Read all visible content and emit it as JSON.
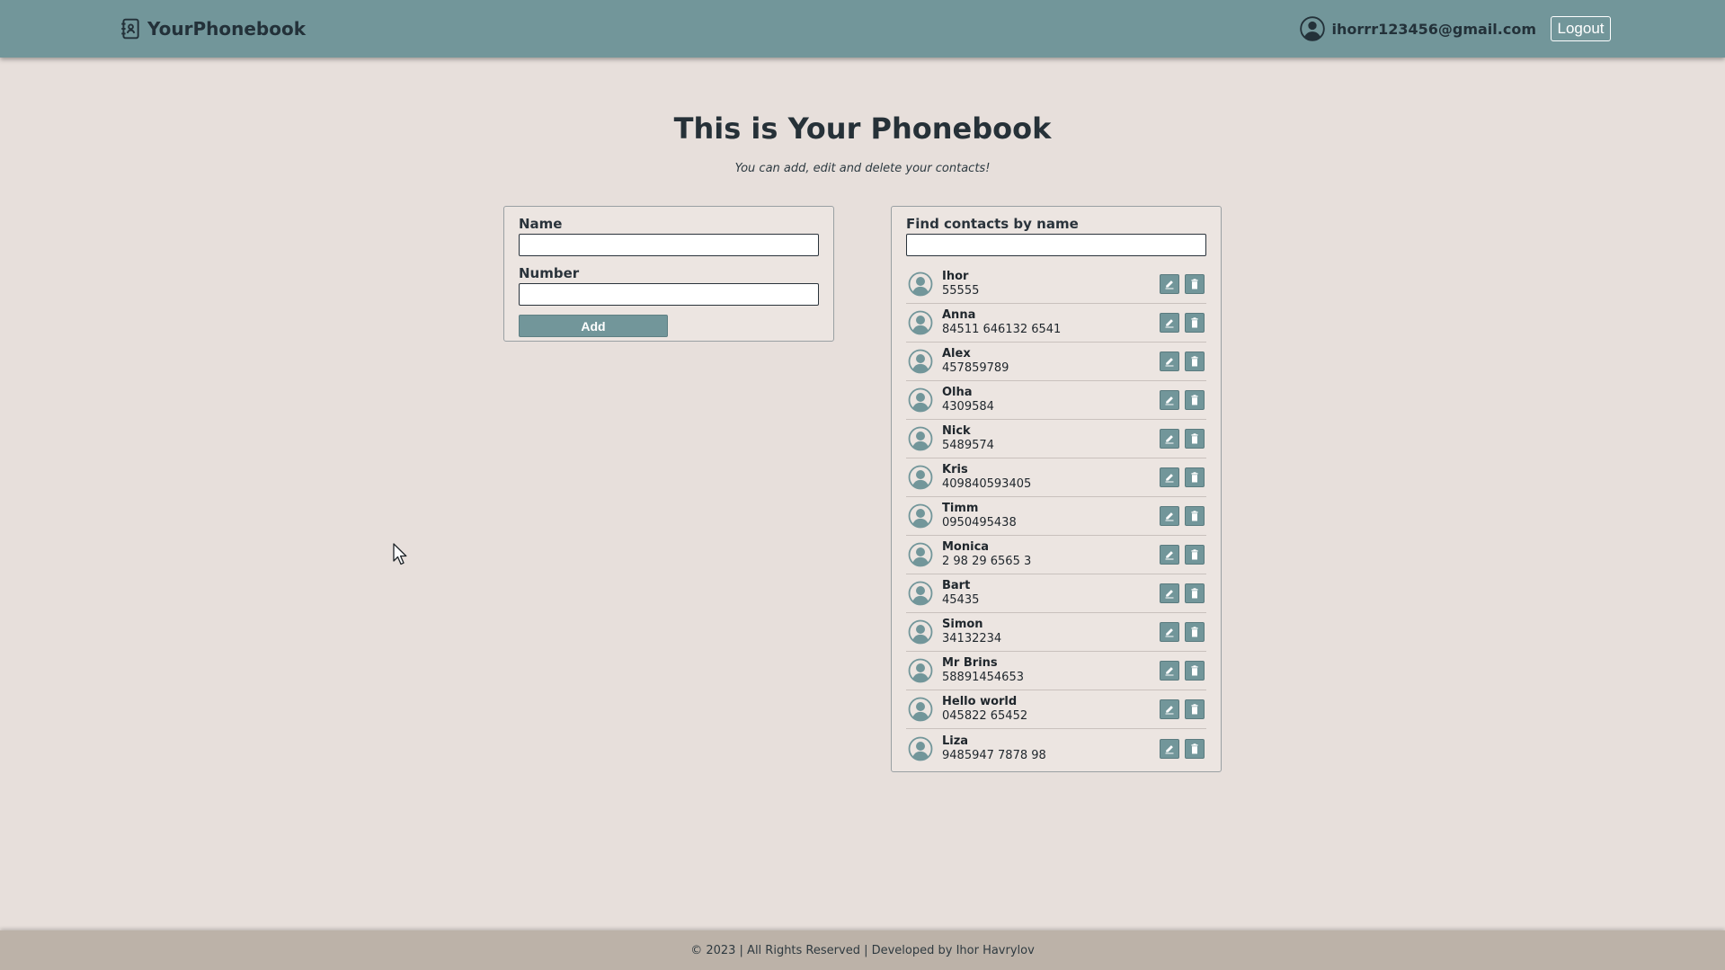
{
  "header": {
    "logo_text": "YourPhonebook",
    "user_email": "ihorrr123456@gmail.com",
    "logout_label": "Logout"
  },
  "main": {
    "title": "This is Your Phonebook",
    "subtitle": "You can add, edit and delete your contacts!"
  },
  "form": {
    "name_label": "Name",
    "name_value": "",
    "number_label": "Number",
    "number_value": "",
    "add_label": "Add"
  },
  "search": {
    "label": "Find contacts by name",
    "value": ""
  },
  "contacts": [
    {
      "name": "Ihor",
      "number": "55555"
    },
    {
      "name": "Anna",
      "number": "84511 646132 6541"
    },
    {
      "name": "Alex",
      "number": "457859789"
    },
    {
      "name": "Olha",
      "number": "4309584"
    },
    {
      "name": "Nick",
      "number": "5489574"
    },
    {
      "name": "Kris",
      "number": "409840593405"
    },
    {
      "name": "Timm",
      "number": "0950495438"
    },
    {
      "name": "Monica",
      "number": "2 98 29 6565 3"
    },
    {
      "name": "Bart",
      "number": "45435"
    },
    {
      "name": "Simon",
      "number": "34132234"
    },
    {
      "name": "Mr Brins",
      "number": "58891454653"
    },
    {
      "name": "Hello world",
      "number": "045822 65452"
    },
    {
      "name": "Liza",
      "number": "9485947 7878 98"
    }
  ],
  "icons": {
    "logo": "address-book-icon",
    "user": "user-circle-icon",
    "avatar": "avatar-icon",
    "edit": "pencil-icon",
    "delete": "trash-icon"
  },
  "colors": {
    "header_bg": "#72969a",
    "page_bg": "#e7dfdb",
    "footer_bg": "#bcb2a8",
    "accent": "#72969a"
  },
  "footer": {
    "text": "© 2023 | All Rights Reserved | Developed by Ihor Havrylov"
  }
}
